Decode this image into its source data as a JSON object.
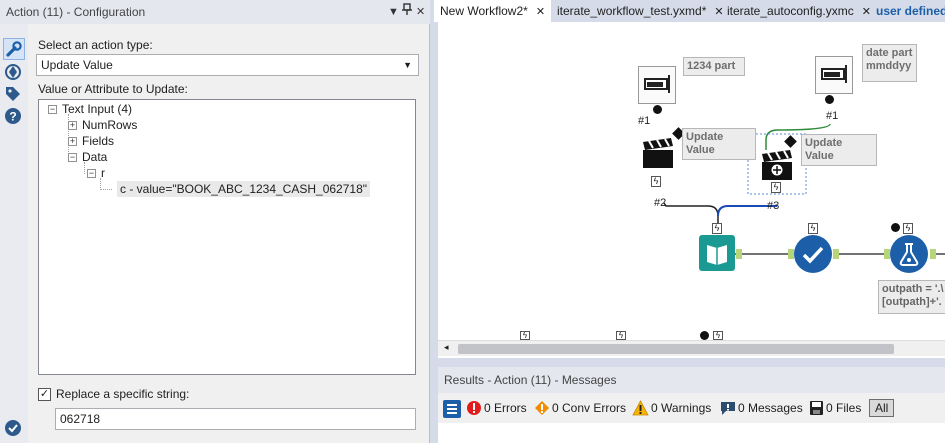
{
  "config_panel": {
    "title": "Action (11) - Configuration",
    "controls": {
      "dropdown": "▼",
      "pin": "🖈",
      "close": "✕"
    },
    "action_type_label": "Select an action type:",
    "action_type_value": "Update Value",
    "value_label": "Value or Attribute to Update:",
    "tree": {
      "root": "Text Input (4)",
      "numrows": "NumRows",
      "fields": "Fields",
      "data": "Data",
      "r": "r",
      "c_value": "c - value=\"BOOK_ABC_1234_CASH_062718\""
    },
    "replace_checkbox_label": "Replace a specific string:",
    "replace_checked": true,
    "replace_value": "062718"
  },
  "tabs": [
    {
      "label": "New Workflow2*",
      "close": "✕"
    },
    {
      "label": "iterate_workflow_test.yxmd*",
      "close": "✕"
    },
    {
      "label": "iterate_autoconfig.yxmc",
      "close": "✕"
    },
    {
      "label": "user defined c"
    }
  ],
  "canvas": {
    "annot_1234": "1234 part",
    "annot_date_line1": "date part",
    "annot_date_line2": "mmddyy",
    "update_value_1": "Update Value",
    "update_value_2": "Update Value",
    "conn_1a": "#1",
    "conn_1b": "#1",
    "conn_2": "#2",
    "conn_3": "#3",
    "formula_line1": "outpath = '.\\",
    "formula_line2": "[outpath]+'."
  },
  "results": {
    "title": "Results - Action (11) - Messages",
    "errors": "0 Errors",
    "conv_errors": "0 Conv Errors",
    "warnings": "0 Warnings",
    "messages": "0 Messages",
    "files": "0 Files",
    "all_button": "All"
  },
  "colors": {
    "accent_blue": "#1c5fa8",
    "browse_teal": "#1a9a92",
    "connector_green": "#2e8b3a",
    "connector_blue": "#1c49b8",
    "error_red": "#e21b1b",
    "warning_orange": "#f08a00"
  }
}
